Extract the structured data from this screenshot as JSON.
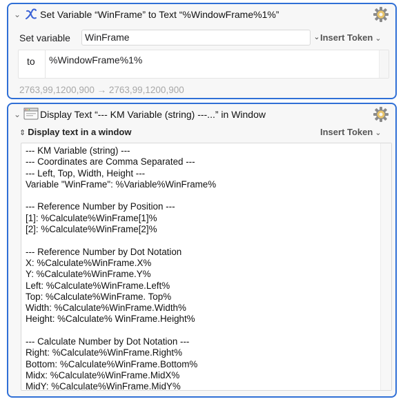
{
  "actions": [
    {
      "title": "Set Variable “WinFrame” to Text “%WindowFrame%1%”",
      "icon": "variable-x-icon",
      "set_variable_label": "Set variable",
      "variable_name": "WinFrame",
      "insert_token_label": "Insert Token",
      "to_label": "to",
      "to_value": "%WindowFrame%1%",
      "result_preview": "2763,99,1200,900 → 2763,99,1200,900"
    },
    {
      "title": "Display Text “--- KM Variable (string) ---...” in Window",
      "icon": "window-icon",
      "mode_label": "Display text in a window",
      "insert_token_label": "Insert Token",
      "text_value": "--- KM Variable (string) ---\n--- Coordinates are Comma Separated ---\n--- Left, Top, Width, Height ---\nVariable \"WinFrame\": %Variable%WinFrame%\n\n--- Reference Number by Position ---\n[1]: %Calculate%WinFrame[1]%\n[2]: %Calculate%WinFrame[2]%\n\n--- Reference Number by Dot Notation\nX: %Calculate%WinFrame.X%\nY: %Calculate%WinFrame.Y%\nLeft: %Calculate%WinFrame.Left%\nTop: %Calculate%WinFrame. Top%\nWidth: %Calculate%WinFrame.Width%\nHeight: %Calculate% WinFrame.Height%\n\n--- Calculate Number by Dot Notation ---\nRight: %Calculate%WinFrame.Right%\nBottom: %Calculate%WinFrame.Bottom%\nMidx: %Calculate%WinFrame.MidX%\nMidY: %Calculate%WinFrame.MidY%"
    }
  ],
  "colors": {
    "accent": "#2f6fd6",
    "result_text": "#a8a8a8",
    "variable_icon": "#3b63d6"
  }
}
